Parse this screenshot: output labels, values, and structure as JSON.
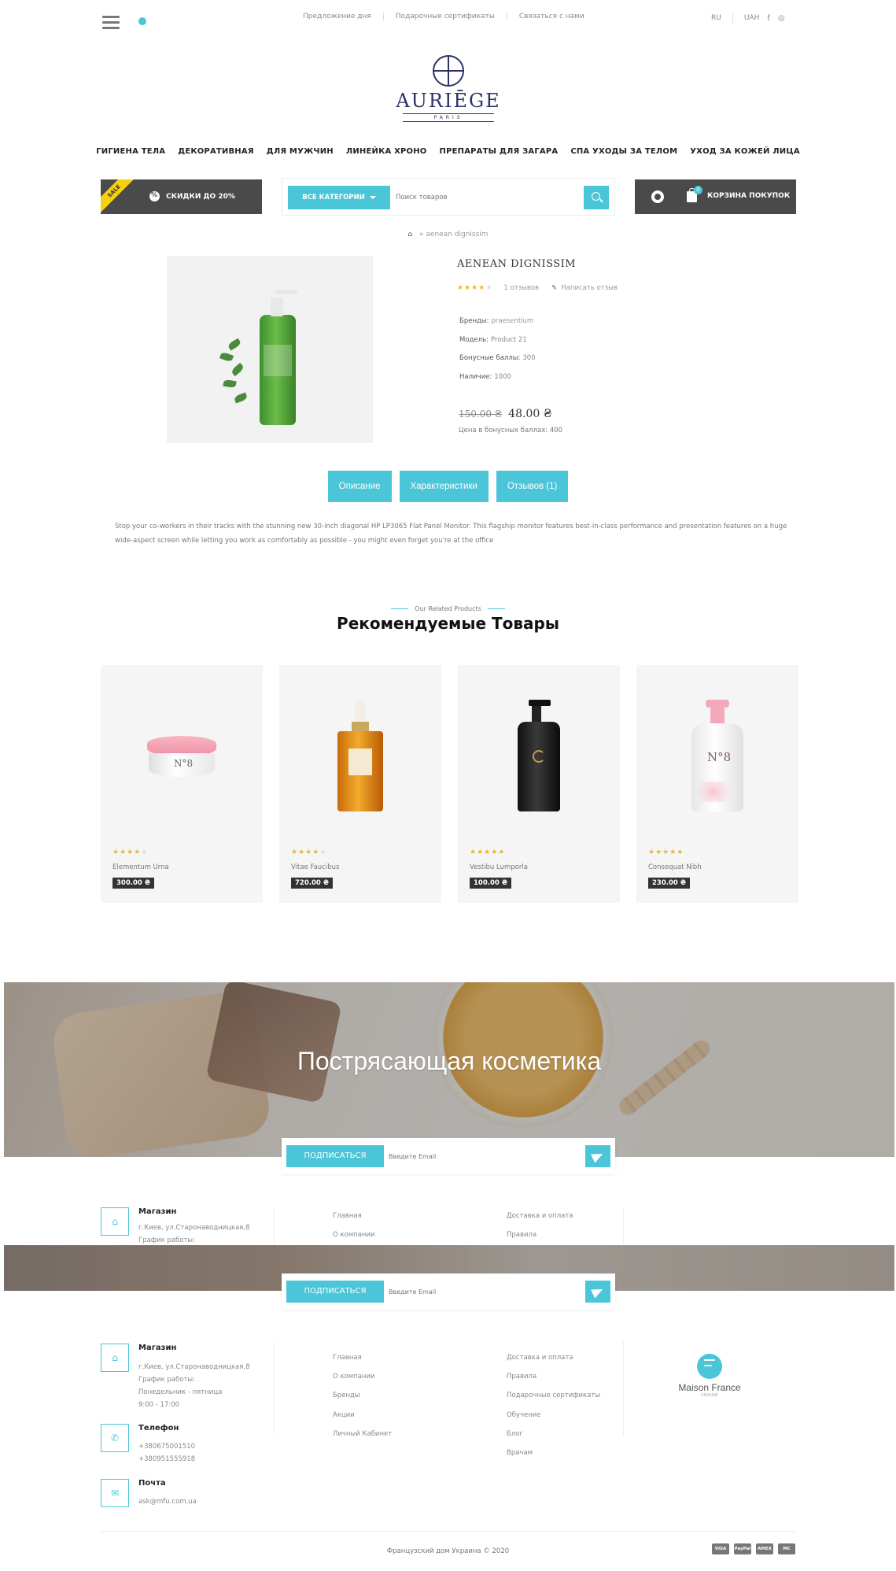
{
  "topbar": {
    "links": [
      "Предложение дня",
      "Подарочные сертификаты",
      "Связаться с нами"
    ],
    "language": "RU",
    "currency": "UAH"
  },
  "logo": {
    "name": "AURIĒGE",
    "sub": "PARIS"
  },
  "main_nav": [
    "ГИГИЕНА ТЕЛА",
    "ДЕКОРАТИВНАЯ",
    "ДЛЯ МУЖЧИН",
    "ЛИНЕЙКА ХРОНО",
    "ПРЕПАРАТЫ ДЛЯ ЗАГАРА",
    "СПА УХОДЫ ЗА ТЕЛОМ",
    "УХОД ЗА КОЖЕЙ ЛИЦА"
  ],
  "sale": {
    "tag": "SALE",
    "label": "СКИДКИ ДО 20%"
  },
  "search": {
    "category_button": "ВСЕ КАТЕГОРИИ",
    "placeholder": "Поиск товаров"
  },
  "cart": {
    "label": "КОРЗИНА ПОКУПОК",
    "count": "0"
  },
  "breadcrumb": {
    "current": "aenean dignissim"
  },
  "product": {
    "title": "AENEAN DIGNISSIM",
    "rating": 4,
    "reviews": "1 отзывов",
    "write_review": "Написать отзыв",
    "specs": [
      {
        "label": "Бренды:",
        "value": "praesentium"
      },
      {
        "label": "Модель:",
        "value": "Product 21"
      },
      {
        "label": "Бонусные баллы:",
        "value": "300"
      },
      {
        "label": "Наличие:",
        "value": "1000"
      }
    ],
    "old_price": "150.00 ₴",
    "new_price": "48.00 ₴",
    "bonus_price": "Цена в бонусных баллах: 400"
  },
  "tabs": [
    "Описание",
    "Характеристики",
    "Отзывов (1)"
  ],
  "description": "Stop your co-workers in their tracks with the stunning new 30-inch diagonal HP LP3065 Flat Panel Monitor. This flagship monitor features best-in-class performance and presentation features on a huge wide-aspect screen while letting you work as comfortably as possible - you might even forget you're at the office",
  "related": {
    "kicker": "Our Related Products",
    "title": "Рекомендуемые Товары",
    "items": [
      {
        "name": "Elementum Urna",
        "price": "300.00 ₴",
        "rating": 4
      },
      {
        "name": "Vitae Faucibus",
        "price": "720.00 ₴",
        "rating": 4
      },
      {
        "name": "Vestibu Lumporla",
        "price": "100.00 ₴",
        "rating": 5
      },
      {
        "name": "Consequat Nibh",
        "price": "230.00 ₴",
        "rating": 5
      }
    ]
  },
  "banner": {
    "title": "Пострясающая косметика"
  },
  "subscribe": {
    "button": "ПОДПИСАТЬСЯ",
    "placeholder": "Введите Email"
  },
  "footer": {
    "shop": {
      "title": "Магазин",
      "lines": [
        "г.Киев, ул.Старонаводницкая,8",
        "График работы:",
        "Понедельник - пятница",
        "9:00 - 17:00"
      ]
    },
    "phone": {
      "title": "Телефон",
      "lines": [
        "+380675001510",
        "+380951555918"
      ]
    },
    "mail": {
      "title": "Почта",
      "lines": [
        "ask@mfu.com.ua"
      ]
    },
    "col1": [
      "Главная",
      "О компании",
      "Бренды",
      "Акции",
      "Личный Кабинет"
    ],
    "col2": [
      "Доставка и оплата",
      "Правила",
      "Подарочные сертификаты",
      "Обучение",
      "Блог",
      "Врачам"
    ],
    "brand": {
      "name": "Maison France",
      "sub": "UKRAINE"
    },
    "copyright": "Французский дом Украина © 2020",
    "payments": [
      "VISA",
      "PayPal",
      "AMEX",
      "MC"
    ]
  },
  "colors": {
    "accent": "#4ac6d8",
    "dark": "#4a4a4a",
    "star": "#f6b619"
  }
}
